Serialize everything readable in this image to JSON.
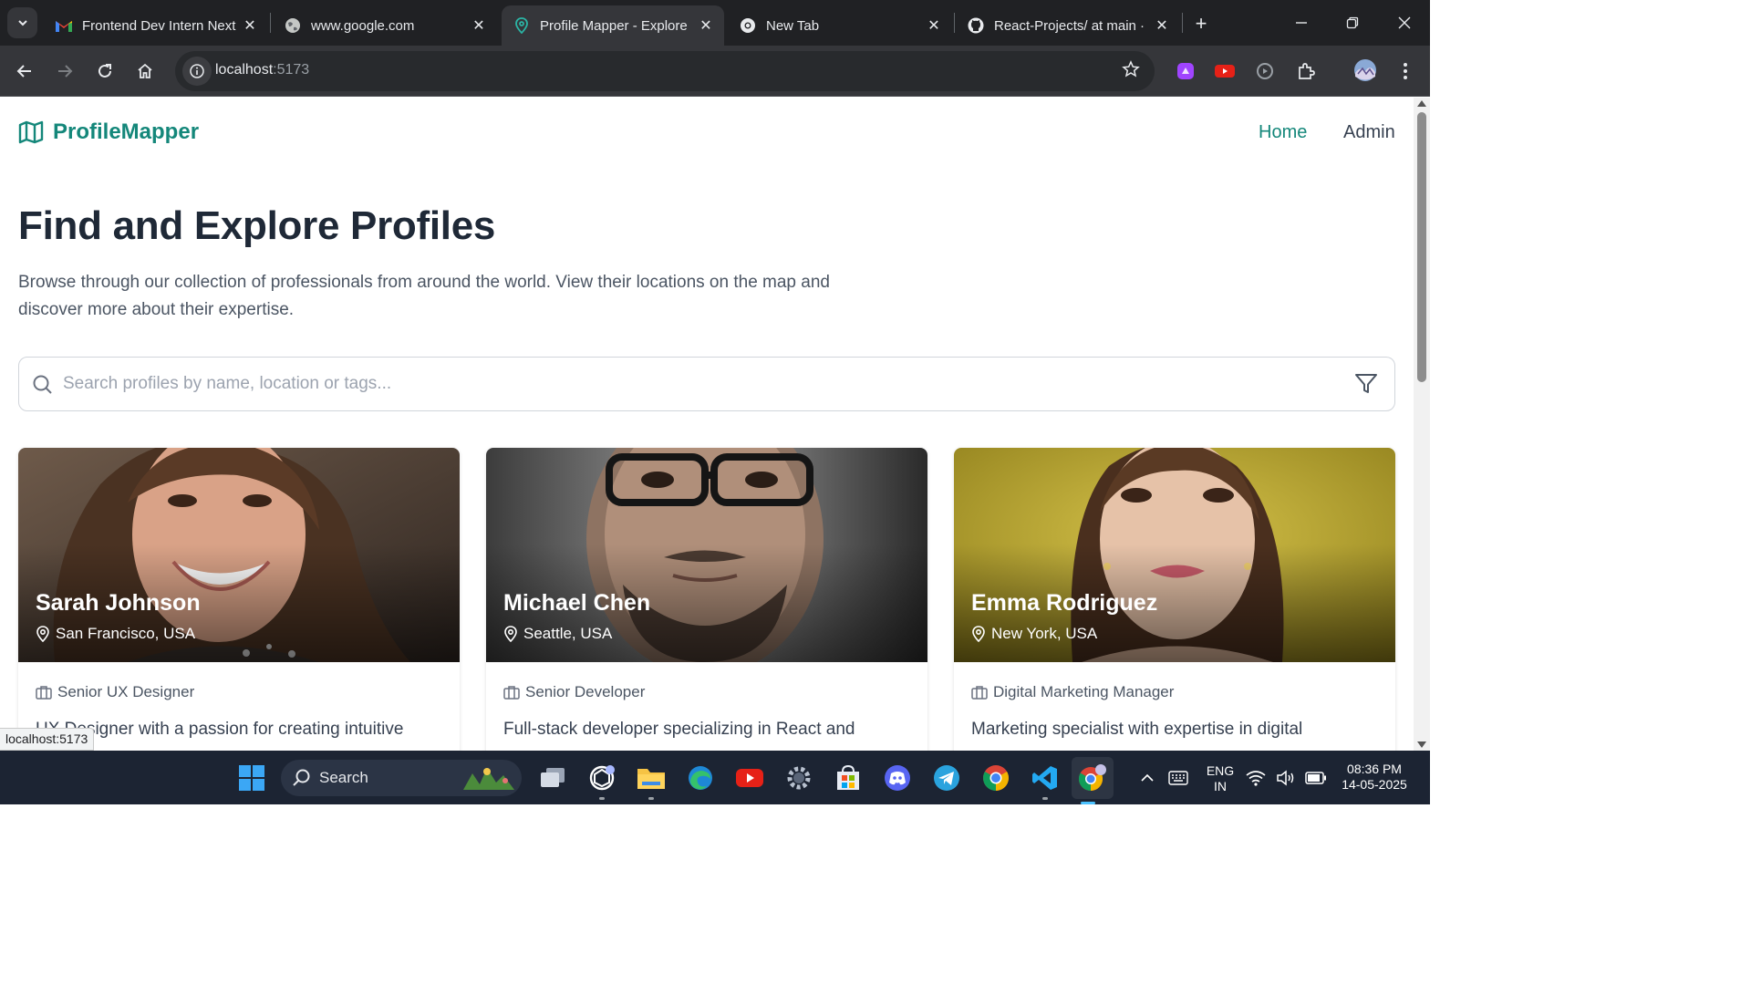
{
  "browser": {
    "tabs": [
      {
        "title": "Frontend Dev Intern Next",
        "icon": "gmail-icon"
      },
      {
        "title": "www.google.com",
        "icon": "globe-icon"
      },
      {
        "title": "Profile Mapper - Explore",
        "icon": "map-pin-icon",
        "active": true
      },
      {
        "title": "New Tab",
        "icon": "chrome-icon"
      },
      {
        "title": "React-Projects/ at main ·",
        "icon": "github-icon"
      }
    ],
    "url_host": "localhost",
    "url_port": ":5173",
    "status_url": "localhost:5173"
  },
  "nav": {
    "brand": "ProfileMapper",
    "links": [
      "Home",
      "Admin"
    ]
  },
  "hero": {
    "title": "Find and Explore Profiles",
    "subtitle": "Browse through our collection of professionals from around the world. View their locations on the map and discover more about their expertise."
  },
  "search": {
    "placeholder": "Search profiles by name, location or tags..."
  },
  "profiles": [
    {
      "name": "Sarah Johnson",
      "location": "San Francisco, USA",
      "role": "Senior UX Designer",
      "description": "UX Designer with a passion for creating intuitive"
    },
    {
      "name": "Michael Chen",
      "location": "Seattle, USA",
      "role": "Senior Developer",
      "description": "Full-stack developer specializing in React and"
    },
    {
      "name": "Emma Rodriguez",
      "location": "New York, USA",
      "role": "Digital Marketing Manager",
      "description": "Marketing specialist with expertise in digital"
    }
  ],
  "taskbar": {
    "search_label": "Search",
    "lang": "ENG",
    "region": "IN",
    "time": "08:36 PM",
    "date": "14-05-2025"
  },
  "colors": {
    "brand": "#14877a",
    "chrome_dark": "#202124",
    "heading": "#1f2937"
  }
}
